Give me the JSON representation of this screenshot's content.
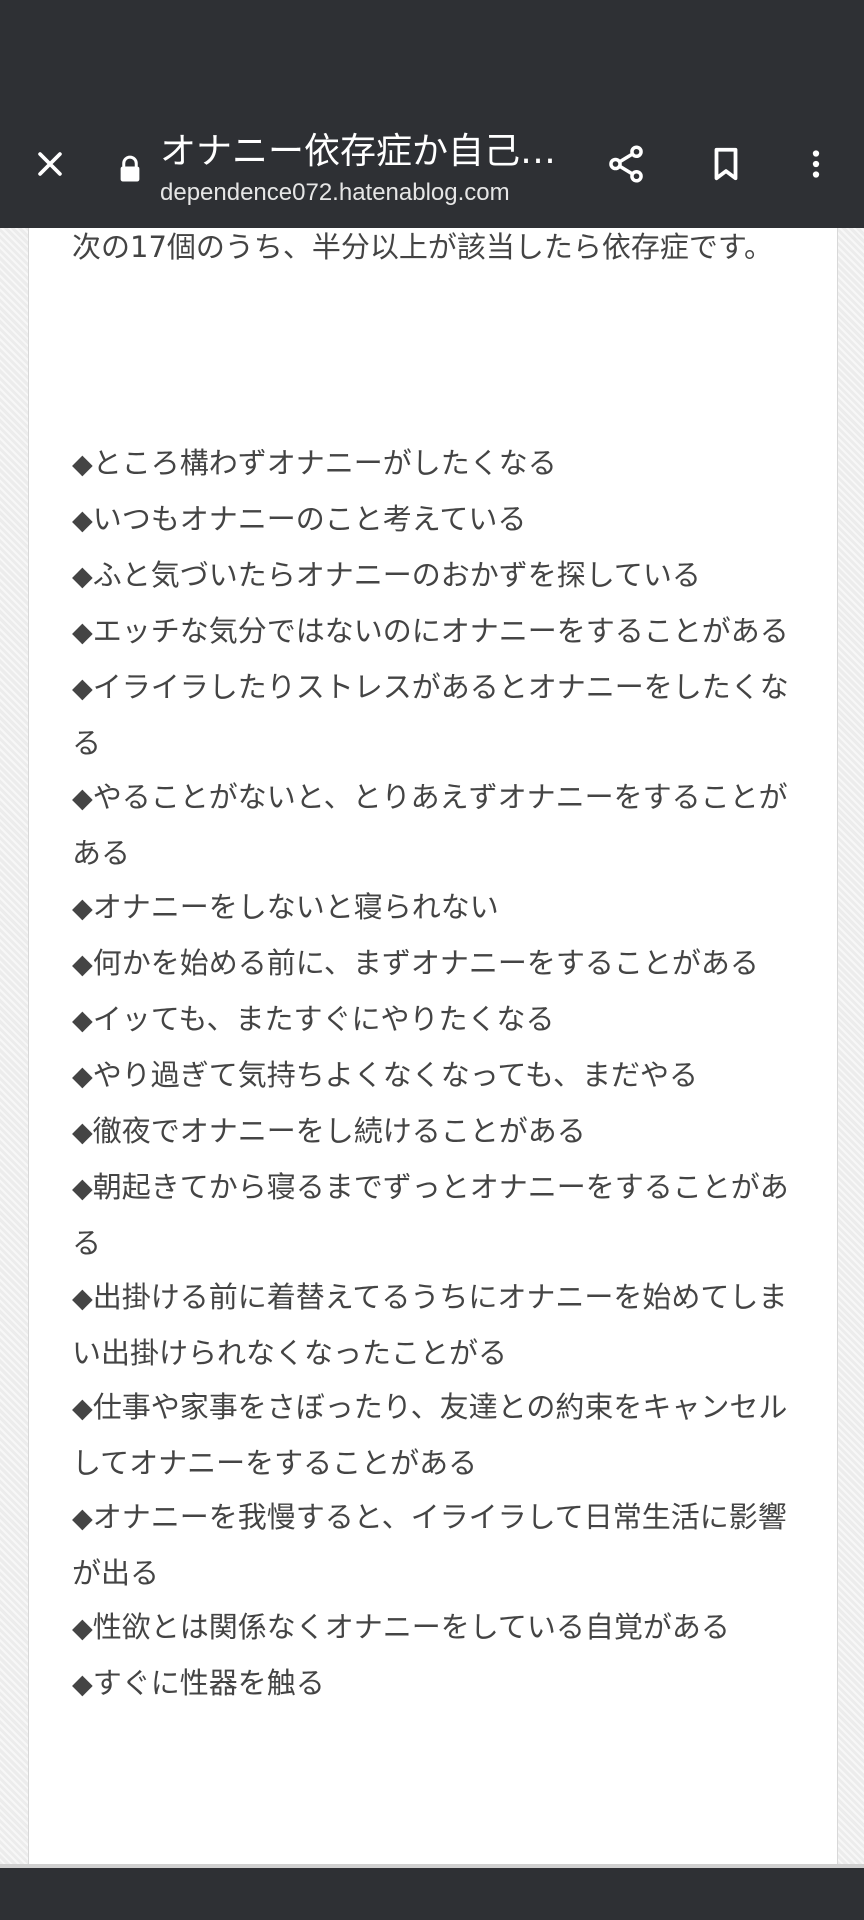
{
  "browser": {
    "page_title": "オナニー依存症か自己…",
    "url": "dependence072.hatenablog.com",
    "icons": {
      "close": "close-icon",
      "lock": "lock-icon",
      "share": "share-icon",
      "bookmark": "bookmark-icon",
      "menu": "more-vert-icon"
    },
    "colors": {
      "toolbar_bg": "#2e3034",
      "toolbar_text": "#ffffff"
    }
  },
  "article": {
    "intro": "次の17個のうち、半分以上が該当したら依存症です。",
    "bullet_symbol": "◆",
    "items": [
      "ところ構わずオナニーがしたくなる",
      "いつもオナニーのこと考えている",
      "ふと気づいたらオナニーのおかずを探している",
      "エッチな気分ではないのにオナニーをすることがある",
      "イライラしたりストレスがあるとオナニーをしたくなる",
      "やることがないと、とりあえずオナニーをすることがある",
      "オナニーをしないと寝られない",
      "何かを始める前に、まずオナニーをすることがある",
      "イッても、またすぐにやりたくなる",
      "やり過ぎて気持ちよくなくなっても、まだやる",
      "徹夜でオナニーをし続けることがある",
      "朝起きてから寝るまでずっとオナニーをすることがある",
      "出掛ける前に着替えてるうちにオナニーを始めてしまい出掛けられなくなったことがる",
      "仕事や家事をさぼったり、友達との約束をキャンセルしてオナニーをすることがある",
      "オナニーを我慢すると、イライラして日常生活に影響が出る",
      "性欲とは関係なくオナニーをしている自覚がある",
      "すぐに性器を触る"
    ],
    "colors": {
      "text": "#444444",
      "background": "#ffffff"
    }
  }
}
